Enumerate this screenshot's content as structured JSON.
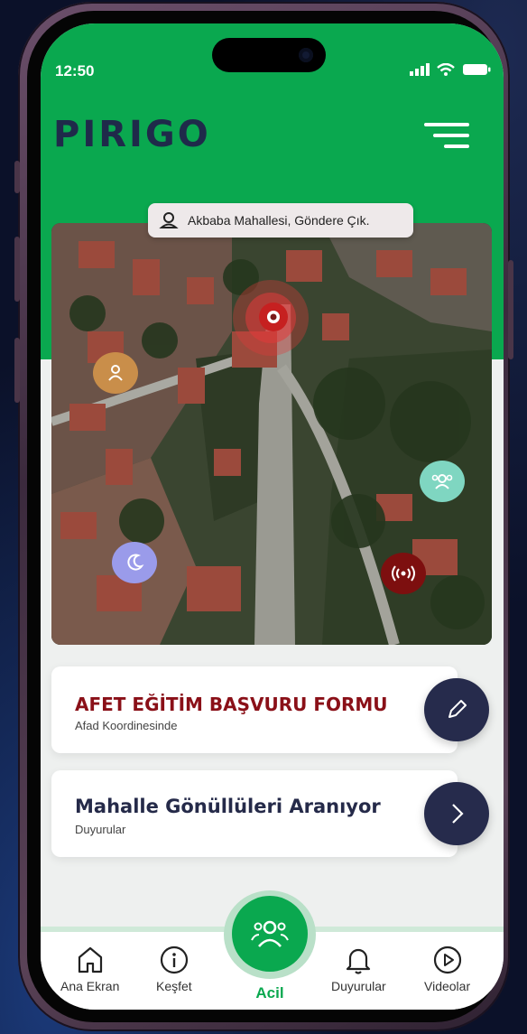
{
  "status_bar": {
    "time": "12:50"
  },
  "header": {
    "logo": "PIRIGO"
  },
  "location": {
    "address": "Akbaba Mahallesi, Göndere Çık."
  },
  "map": {
    "markers": [
      {
        "name": "person",
        "color": "#c98e4a"
      },
      {
        "name": "group",
        "color": "#7fd6c1"
      },
      {
        "name": "night",
        "color": "#9a9bea"
      },
      {
        "name": "signal",
        "color": "#7d0f0f"
      },
      {
        "name": "alert-location",
        "color": "#d42a2a"
      }
    ]
  },
  "cards": [
    {
      "title": "AFET EĞİTİM BAŞVURU FORMU",
      "subtitle": "Afad Koordinesinde",
      "title_color": "#8a1018",
      "action_icon": "pencil-icon"
    },
    {
      "title": "Mahalle Gönüllüleri Aranıyor",
      "subtitle": "Duyurular",
      "title_color": "#252a49",
      "action_icon": "chevron-right-icon"
    }
  ],
  "tabs": [
    {
      "label": "Ana Ekran",
      "icon": "home-icon"
    },
    {
      "label": "Keşfet",
      "icon": "info-icon"
    },
    {
      "label": "Acil",
      "icon": "users-icon"
    },
    {
      "label": "Duyurular",
      "icon": "bell-icon"
    },
    {
      "label": "Videolar",
      "icon": "play-icon"
    }
  ],
  "colors": {
    "brand_green": "#0aa84f",
    "navy": "#262b4c"
  }
}
